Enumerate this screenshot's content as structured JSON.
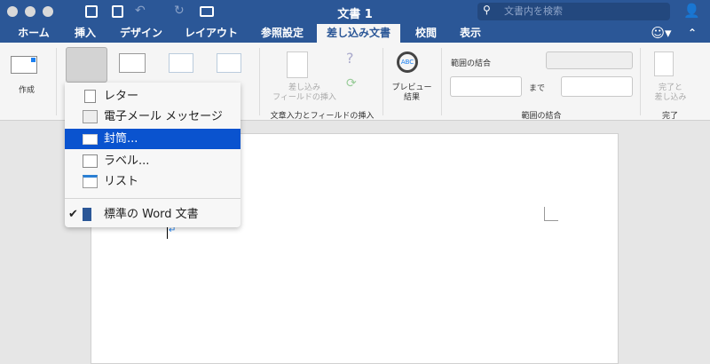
{
  "window": {
    "title": "文書 1",
    "search_placeholder": "文書内を検索"
  },
  "tabs": [
    {
      "label": "ホーム"
    },
    {
      "label": "挿入"
    },
    {
      "label": "デザイン"
    },
    {
      "label": "レイアウト"
    },
    {
      "label": "参照設定"
    },
    {
      "label": "差し込み文書",
      "active": true
    },
    {
      "label": "校閲"
    },
    {
      "label": "表示"
    }
  ],
  "ribbon": {
    "create_label": "作成",
    "insert_field_label": "差し込み\nフィールドの挿入",
    "group_insert": "文章入力とフィールドの挿入",
    "preview_label": "プレビュー\n結果",
    "merge_range_label": "範囲の結合",
    "to_label": "まで",
    "group_range": "範囲の結合",
    "finish_label": "完了と\n差し込み",
    "group_finish": "完了",
    "preview_icon_text": "ABC"
  },
  "menu": {
    "items": [
      {
        "label": "レター",
        "icon": "letter-icon"
      },
      {
        "label": "電子メール メッセージ",
        "icon": "email-icon"
      },
      {
        "label": "封筒...",
        "icon": "envelope-icon",
        "selected": true
      },
      {
        "label": "ラベル...",
        "icon": "label-icon"
      },
      {
        "label": "リスト",
        "icon": "list-icon"
      }
    ],
    "normal": {
      "label": "標準の Word 文書",
      "checked": true,
      "check": "✔"
    }
  },
  "colors": {
    "brand": "#2b5797",
    "selection": "#0a53cf"
  }
}
